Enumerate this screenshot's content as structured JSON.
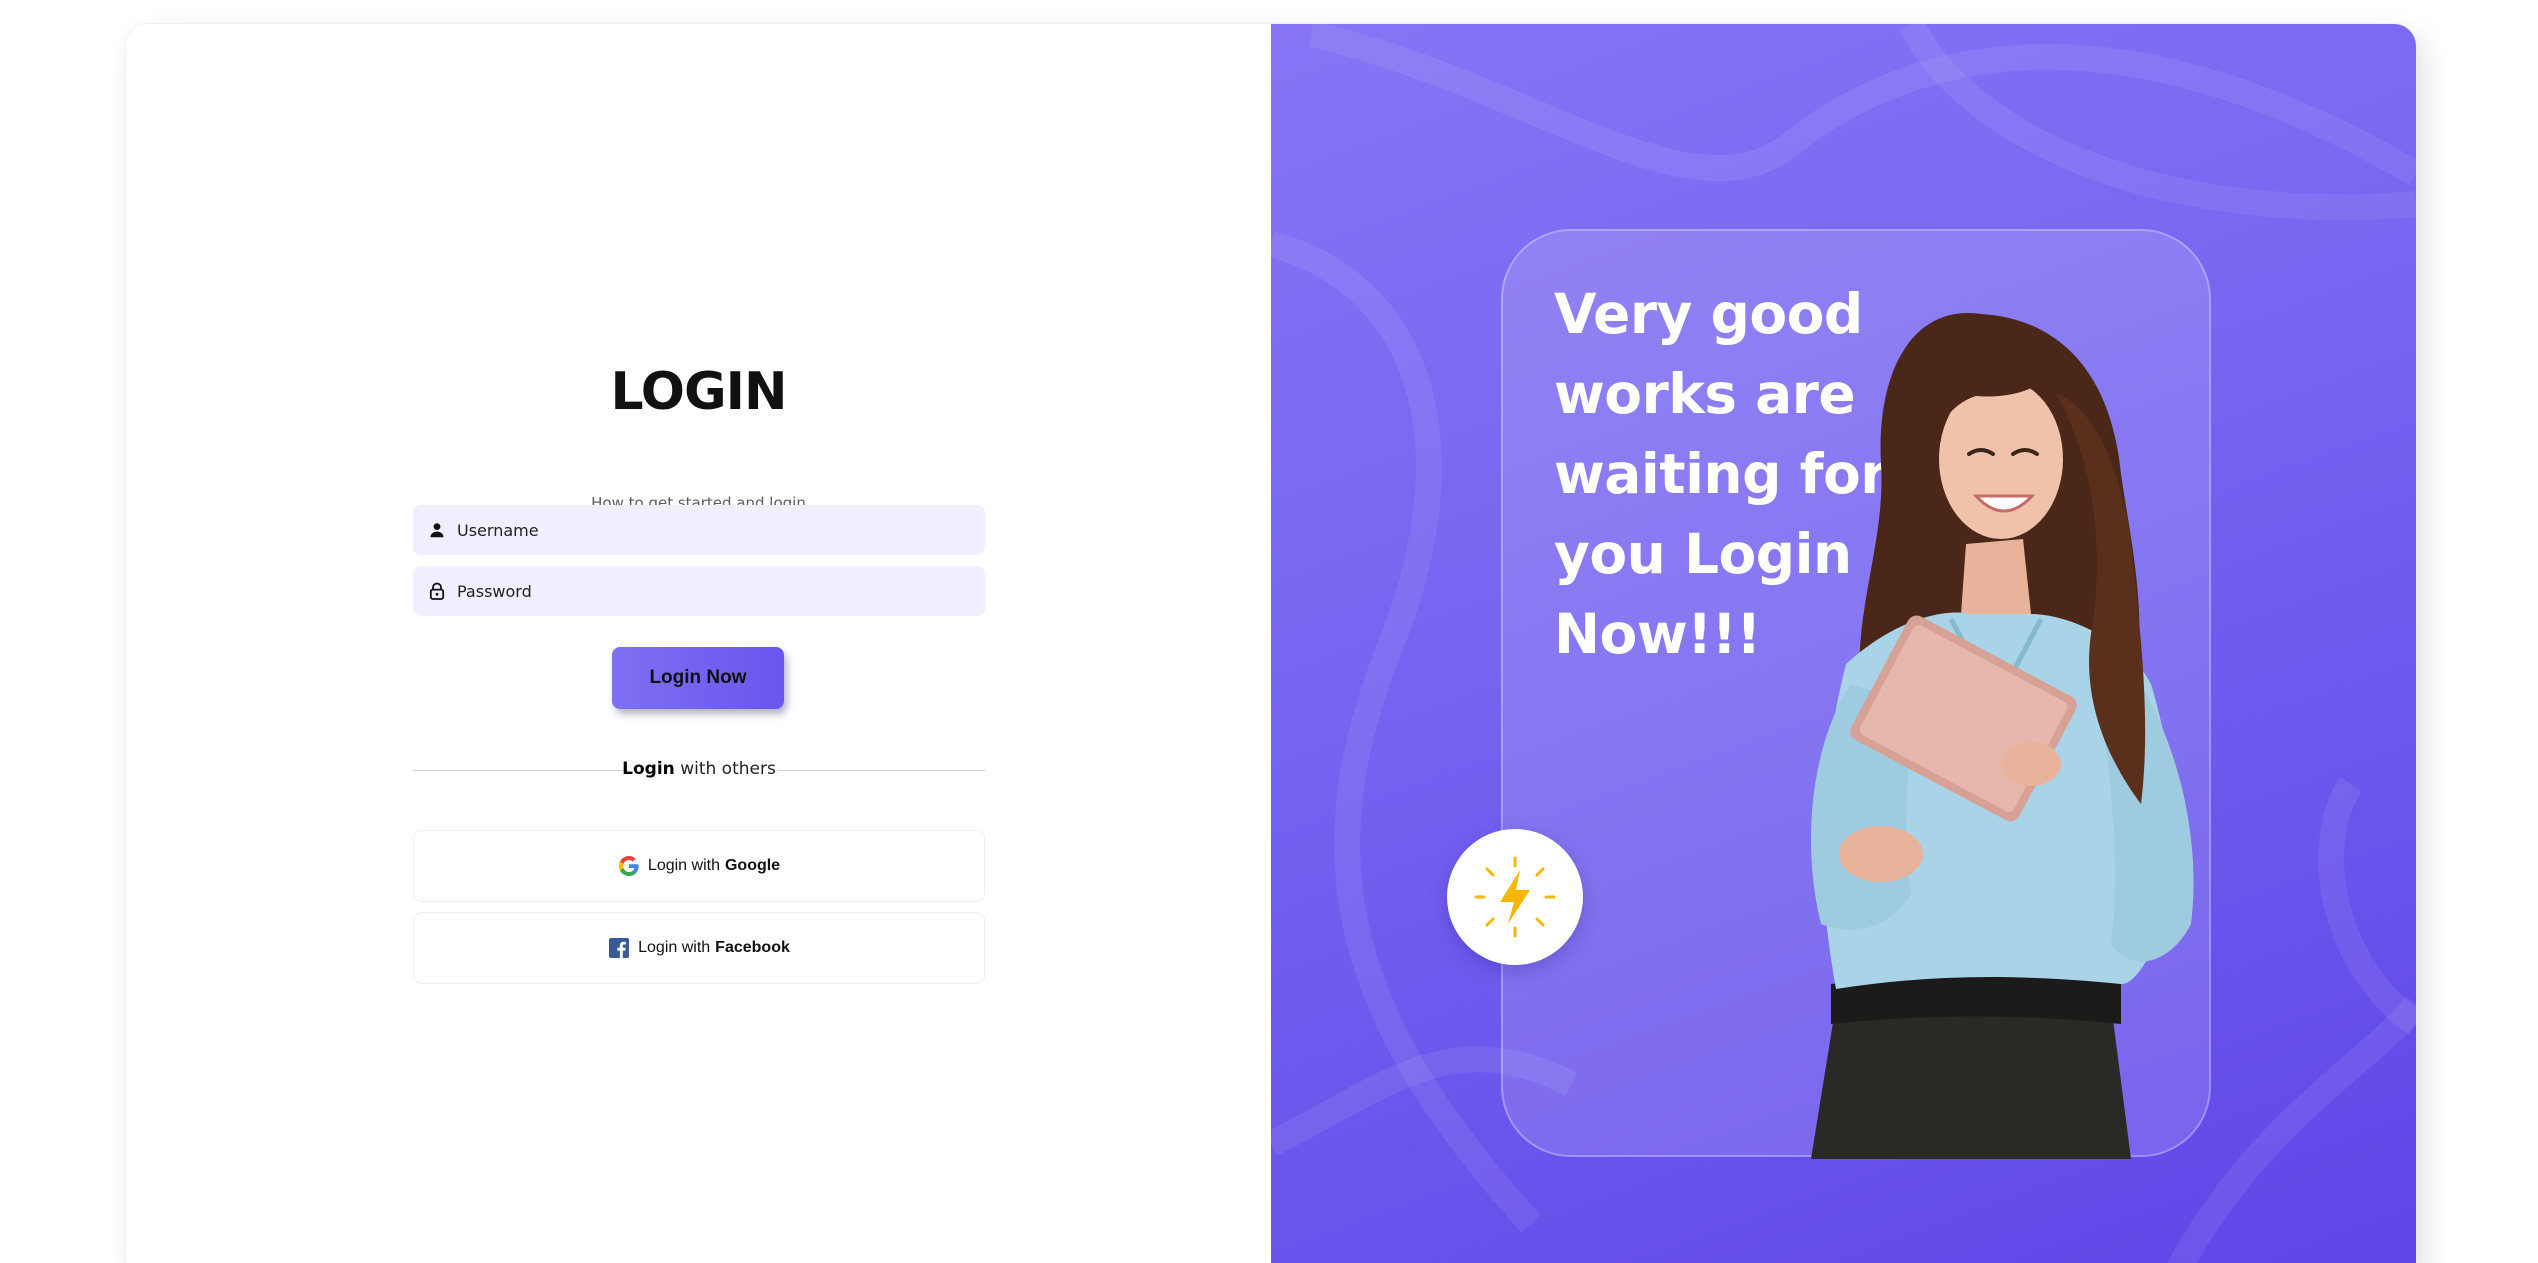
{
  "login": {
    "title": "LOGIN",
    "subtitle": "How to get started and login",
    "username_placeholder": "Username",
    "password_placeholder": "Password",
    "submit_label": "Login Now",
    "divider": {
      "strong": "Login",
      "rest": " with others"
    },
    "social": [
      {
        "prefix": "Login with",
        "brand": "Google",
        "icon": "google-icon"
      },
      {
        "prefix": "Login with",
        "brand": "Facebook",
        "icon": "facebook-icon"
      }
    ]
  },
  "promo": {
    "lines": [
      "Very good",
      "works are",
      "waiting for",
      "you Login",
      "Now!!!"
    ],
    "badge_icon": "lightning-icon",
    "image": "woman-with-tablet-illustration"
  },
  "colors": {
    "accent": "#6c5cf0",
    "accent_dark": "#5e45e8",
    "input_bg": "#f1efff",
    "badge_bolt": "#f5b800"
  }
}
